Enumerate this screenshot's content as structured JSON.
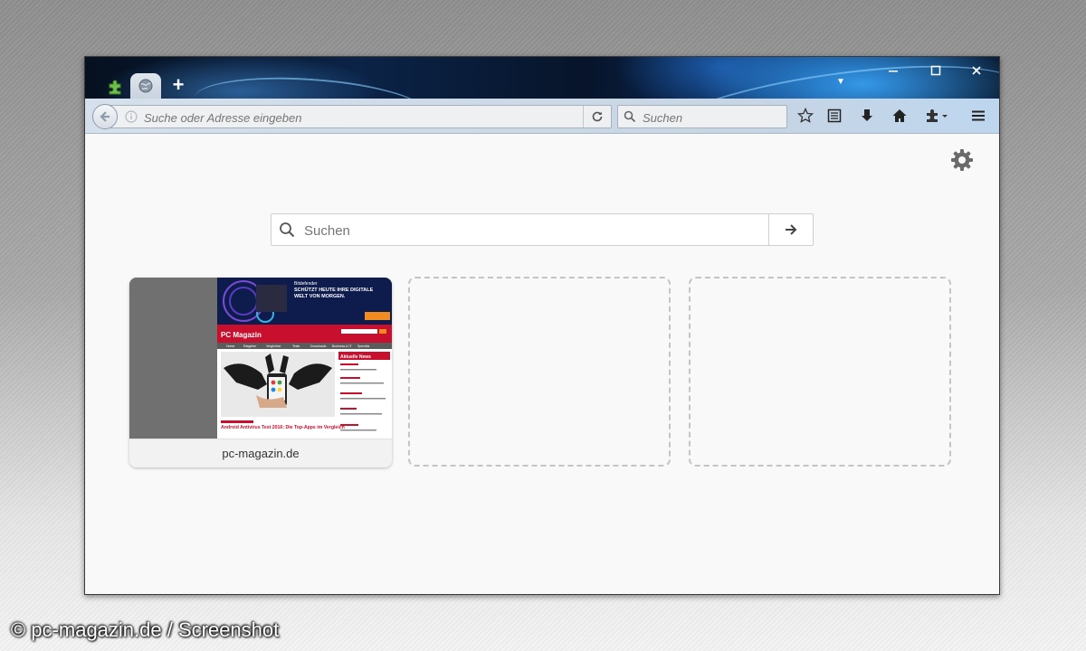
{
  "browser": {
    "tabs": [
      {
        "icon": "puzzle-icon",
        "active": false
      },
      {
        "icon": "globe-icon",
        "active": true
      }
    ],
    "new_tab_label": "+",
    "url_placeholder": "Suche oder Adresse eingeben",
    "search_placeholder": "Suchen",
    "toolbar_icons": [
      "star-icon",
      "reading-list-icon",
      "download-icon",
      "home-icon",
      "addon-icon",
      "menu-icon"
    ],
    "window_controls": [
      "minimize-icon",
      "maximize-icon",
      "close-icon"
    ]
  },
  "newtab": {
    "search_placeholder": "Suchen",
    "tiles": [
      {
        "caption": "pc-magazin.de",
        "filled": true
      },
      {
        "filled": false
      },
      {
        "filled": false
      }
    ],
    "thumbnail": {
      "ad_brand": "Bitdefender",
      "ad_headline_1": "SCHÜTZT HEUTE IHRE DIGITALE",
      "ad_headline_2": "WELT VON MORGEN.",
      "site_title": "PC Magazin",
      "nav_items": [
        "Home",
        "Ratgeber",
        "Vergleiche",
        "Tests",
        "Downloads",
        "Business & IT",
        "Specials"
      ],
      "sidebar_title": "Aktuelle News",
      "article_title": "Android Antivirus Test 2016: Die Top-Apps im Vergleich"
    }
  },
  "watermark": "© pc-magazin.de / Screenshot",
  "colors": {
    "accent": "#1e5fa8",
    "site_red": "#c8102e"
  }
}
